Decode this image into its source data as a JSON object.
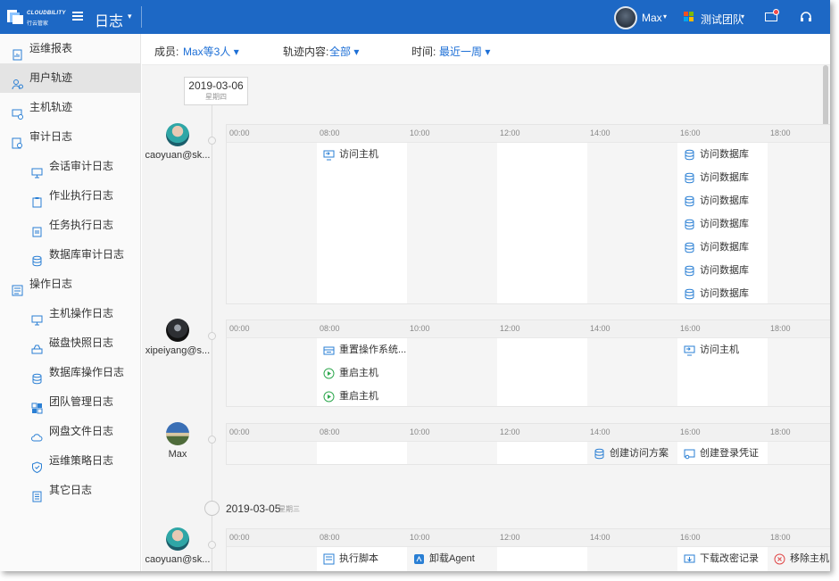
{
  "topbar": {
    "brand": "CLOUDBILITY",
    "brand_sub": "行云管家",
    "title": "日志",
    "user_name": "Max",
    "team_name": "测试团队"
  },
  "sidebar": {
    "items": [
      {
        "label": "运维报表",
        "level": 1,
        "icon": "report-icon"
      },
      {
        "label": "用户轨迹",
        "level": 1,
        "icon": "user-track-icon",
        "active": true
      },
      {
        "label": "主机轨迹",
        "level": 1,
        "icon": "host-track-icon"
      },
      {
        "label": "审计日志",
        "level": 1,
        "icon": "audit-icon"
      },
      {
        "label": "会话审计日志",
        "level": 2,
        "icon": "monitor-icon"
      },
      {
        "label": "作业执行日志",
        "level": 2,
        "icon": "clipboard-icon"
      },
      {
        "label": "任务执行日志",
        "level": 2,
        "icon": "task-icon"
      },
      {
        "label": "数据库审计日志",
        "level": 2,
        "icon": "database-icon"
      },
      {
        "label": "操作日志",
        "level": 1,
        "icon": "operation-log-icon"
      },
      {
        "label": "主机操作日志",
        "level": 2,
        "icon": "monitor-icon"
      },
      {
        "label": "磁盘快照日志",
        "level": 2,
        "icon": "disk-icon"
      },
      {
        "label": "数据库操作日志",
        "level": 2,
        "icon": "database-icon"
      },
      {
        "label": "团队管理日志",
        "level": 2,
        "icon": "team-icon"
      },
      {
        "label": "网盘文件日志",
        "level": 2,
        "icon": "cloud-icon"
      },
      {
        "label": "运维策略日志",
        "level": 2,
        "icon": "shield-icon"
      },
      {
        "label": "其它日志",
        "level": 2,
        "icon": "document-icon"
      }
    ]
  },
  "filters": {
    "member_label": "成员:",
    "member_value": "Max等3人",
    "content_label": "轨迹内容:",
    "content_value": "全部",
    "time_label": "时间:",
    "time_value": "最近一周"
  },
  "timeline": {
    "ticks": [
      "00:00",
      "08:00",
      "10:00",
      "12:00",
      "14:00",
      "16:00",
      "18:00"
    ],
    "day1": {
      "date": "2019-03-06",
      "weekday": "星期四"
    },
    "day2": {
      "date": "2019-03-05",
      "weekday": "星期三"
    },
    "members": [
      {
        "name": "caoyuan@sk...",
        "avatar": "teal"
      },
      {
        "name": "xipeiyang@s...",
        "avatar": "dark"
      },
      {
        "name": "Max",
        "avatar": "landscape"
      },
      {
        "name": "caoyuan@sk...",
        "avatar": "teal"
      }
    ],
    "events": {
      "access_host": "访问主机",
      "access_db": "访问数据库",
      "reset_os": "重置操作系统...",
      "restart_host": "重启主机",
      "create_access_plan": "创建访问方案",
      "create_login_cred": "创建登录凭证",
      "run_script": "执行脚本",
      "uninstall_agent": "卸载Agent",
      "download_change": "下载改密记录",
      "remove_host": "移除主机"
    }
  },
  "colors": {
    "topbar": "#1d68c5",
    "link": "#1d6fd6",
    "icon": "#2a7fd4"
  }
}
